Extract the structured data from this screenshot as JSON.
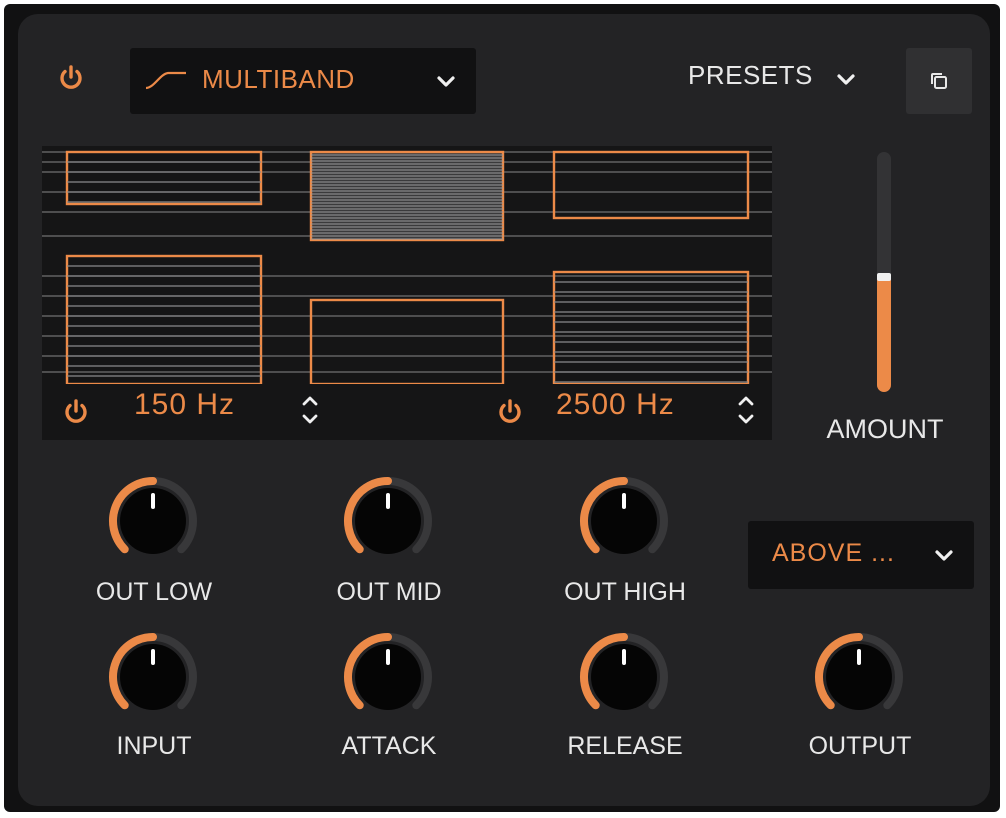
{
  "header": {
    "mode_label": "MULTIBAND",
    "presets_label": "PRESETS"
  },
  "crossovers": [
    {
      "value": "150 Hz"
    },
    {
      "value": "2500 Hz"
    }
  ],
  "amount": {
    "label": "AMOUNT",
    "level_fraction": 0.48
  },
  "knobs": {
    "out_low": {
      "label": "OUT LOW",
      "level_fraction": 0.5
    },
    "out_mid": {
      "label": "OUT MID",
      "level_fraction": 0.5
    },
    "out_high": {
      "label": "OUT HIGH",
      "level_fraction": 0.5
    },
    "input": {
      "label": "INPUT",
      "level_fraction": 0.5
    },
    "attack": {
      "label": "ATTACK",
      "level_fraction": 0.5
    },
    "release": {
      "label": "RELEASE",
      "level_fraction": 0.5
    },
    "output": {
      "label": "OUTPUT",
      "level_fraction": 0.5
    }
  },
  "mode2": {
    "label": "ABOVE ..."
  },
  "icons": [
    "power-icon",
    "curve-icon",
    "chevron-down-icon",
    "copy-icon",
    "up-down-stepper-icon"
  ],
  "colors": {
    "accent": "#ec8a48",
    "background": "#232325",
    "text": "#e8e8e8"
  }
}
